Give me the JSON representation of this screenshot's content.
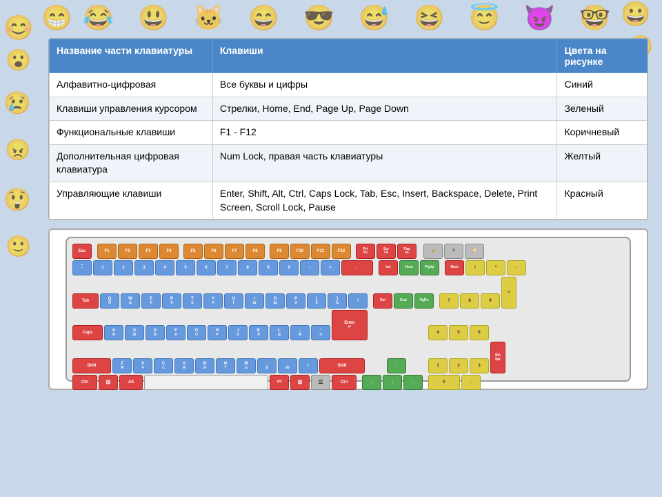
{
  "table": {
    "headers": [
      "Название части клавиатуры",
      "Клавиши",
      "Цвета на рисунке"
    ],
    "rows": [
      {
        "part": "Алфавитно-цифровая",
        "keys": "Все буквы и цифры",
        "color": "Синий"
      },
      {
        "part": "Клавиши управления курсором",
        "keys": "Стрелки, Home, End, Page Up, Page Down",
        "color": "Зеленый"
      },
      {
        "part": "Функциональные клавиши",
        "keys": "F1 - F12",
        "color": "Коричневый"
      },
      {
        "part": "Дополнительная цифровая клавиатура",
        "keys": "Num Lock, правая часть клавиатуры",
        "color": "Желтый"
      },
      {
        "part": "Управляющие клавиши",
        "keys": "Enter, Shift, Alt, Ctrl, Caps Lock, Tab, Esc, Insert, Backspace, Delete, Print Screen, Scroll Lock, Pause",
        "color": "Красный"
      }
    ]
  },
  "keyboard_label": "Keyboard diagram"
}
